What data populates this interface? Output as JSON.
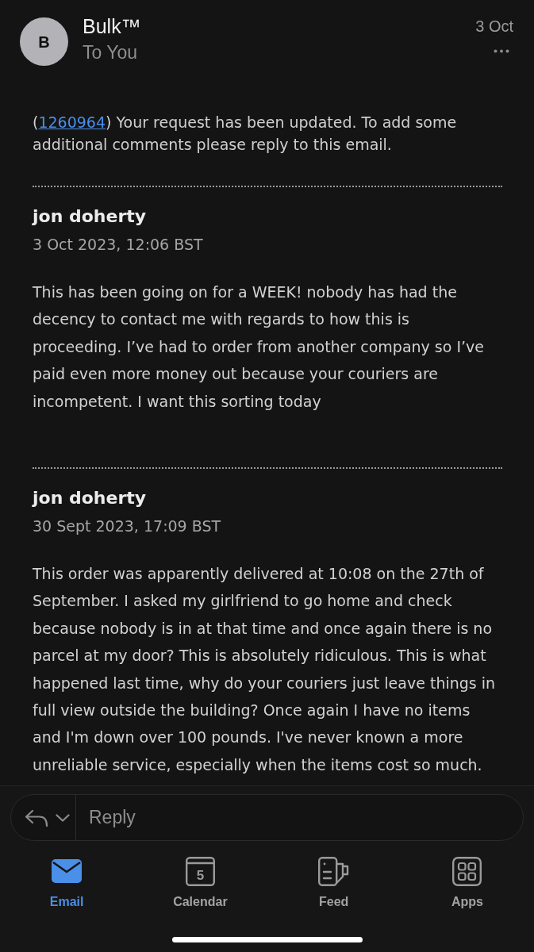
{
  "header": {
    "avatar_initial": "B",
    "sender": "Bulk™",
    "recipient": "To You",
    "date": "3 Oct"
  },
  "intro": {
    "before": "(",
    "link": "1260964",
    "after": ") Your request has been updated. To add some additional comments please reply to this email."
  },
  "messages": [
    {
      "author": "jon doherty",
      "date": "3 Oct 2023, 12:06 BST",
      "body": "This has been going on for a WEEK! nobody has had the decency to contact me with regards to how this is proceeding. I’ve had to order from another company so I’ve paid even more money out because your couriers are incompetent. I want this sorting today"
    },
    {
      "author": "jon doherty",
      "date": "30 Sept 2023, 17:09 BST",
      "body": "This order was apparently delivered at 10:08 on the 27th of September. I asked my girlfriend to go home and check because nobody is in at that time and once again there is no parcel at my door? This is absolutely ridiculous. This is what happened last time, why do your couriers just leave things in full view outside the building? Once again I have no items and I'm down over 100 pounds. I've never known a more unreliable service, especially when the items cost so much."
    }
  ],
  "reply_bar": {
    "placeholder": "Reply"
  },
  "tabs": [
    {
      "kind": "mail",
      "label": "Email",
      "selected": true
    },
    {
      "kind": "calendar",
      "label": "Calendar",
      "selected": false,
      "day": "5"
    },
    {
      "kind": "feed",
      "label": "Feed",
      "selected": false
    },
    {
      "kind": "apps",
      "label": "Apps",
      "selected": false
    }
  ]
}
